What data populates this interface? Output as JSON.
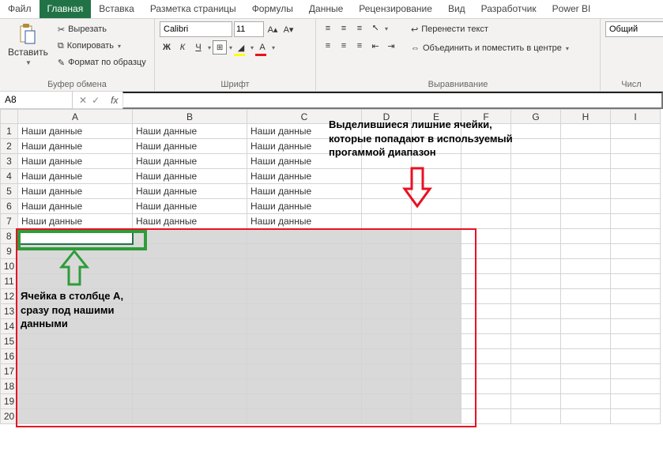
{
  "tabs": {
    "file": "Файл",
    "home": "Главная",
    "insert": "Вставка",
    "layout": "Разметка страницы",
    "formulas": "Формулы",
    "data": "Данные",
    "review": "Рецензирование",
    "view": "Вид",
    "developer": "Разработчик",
    "powerbi": "Power BI"
  },
  "ribbon": {
    "paste": "Вставить",
    "cut": "Вырезать",
    "copy": "Копировать",
    "format_painter": "Формат по образцу",
    "clipboard_group": "Буфер обмена",
    "font_name": "Calibri",
    "font_size": "11",
    "font_group": "Шрифт",
    "bold": "Ж",
    "italic": "К",
    "underline": "Ч",
    "wrap": "Перенести текст",
    "merge": "Объединить и поместить в центре",
    "align_group": "Выравнивание",
    "num_format": "Общий",
    "num_group": "Числ"
  },
  "namebox": {
    "value": "A8",
    "fx": "fx"
  },
  "columns": [
    "A",
    "B",
    "C",
    "D",
    "E",
    "F",
    "G",
    "H",
    "I"
  ],
  "rows": [
    1,
    2,
    3,
    4,
    5,
    6,
    7,
    8,
    9,
    10,
    11,
    12,
    13,
    14,
    15,
    16,
    17,
    18,
    19,
    20
  ],
  "cell_text": "Наши данные",
  "data_rows": 7,
  "data_cols": 3,
  "selection": {
    "r1": 8,
    "r2": 20,
    "c1": 1,
    "c2": 5
  },
  "active_cell": {
    "row": 8,
    "col": 1
  },
  "annot": {
    "right": "Выделившиеся лишние ячейки, которые попадают в используемый прогаммой диапазон",
    "left": "Ячейка в столбце A, сразу под нашими данными"
  },
  "chart_data": {
    "type": "table",
    "columns": [
      "A",
      "B",
      "C"
    ],
    "rows": [
      [
        "Наши данные",
        "Наши данные",
        "Наши данные"
      ],
      [
        "Наши данные",
        "Наши данные",
        "Наши данные"
      ],
      [
        "Наши данные",
        "Наши данные",
        "Наши данные"
      ],
      [
        "Наши данные",
        "Наши данные",
        "Наши данные"
      ],
      [
        "Наши данные",
        "Наши данные",
        "Наши данные"
      ],
      [
        "Наши данные",
        "Наши данные",
        "Наши данные"
      ],
      [
        "Наши данные",
        "Наши данные",
        "Наши данные"
      ]
    ]
  }
}
